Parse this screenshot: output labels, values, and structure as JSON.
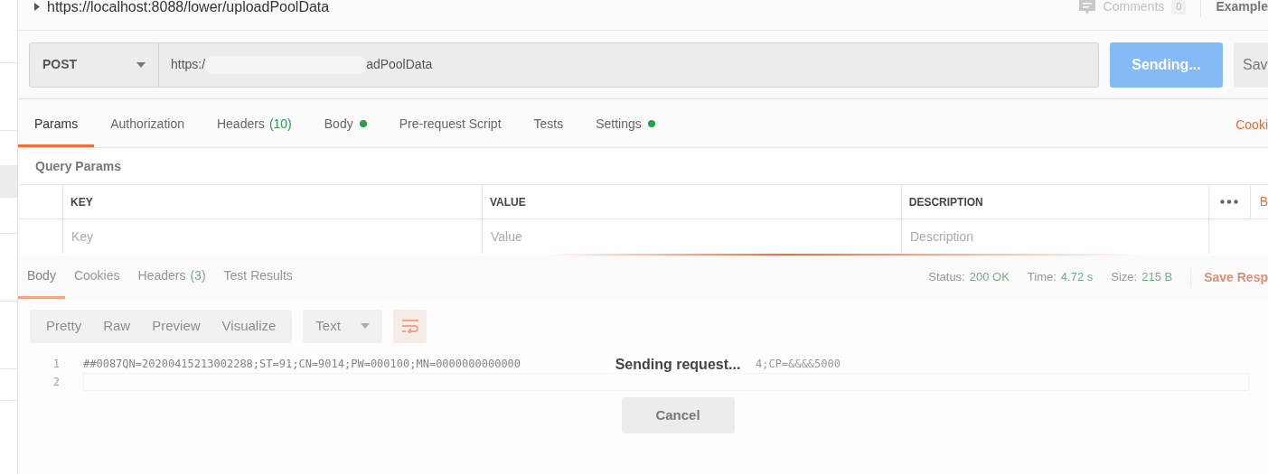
{
  "header": {
    "title": "https://localhost:8088/lower/uploadPoolData",
    "comments_label": "Comments",
    "comments_count": "0",
    "examples": "Example"
  },
  "request": {
    "method": "POST",
    "url_start": "https:/",
    "url_end": "adPoolData",
    "send": "Sending...",
    "save": "Sav"
  },
  "tabs": [
    {
      "label": "Params",
      "selected": true
    },
    {
      "label": "Authorization",
      "selected": false
    },
    {
      "label": "Headers",
      "count": "(10)",
      "selected": false
    },
    {
      "label": "Body",
      "dot": true,
      "selected": false
    },
    {
      "label": "Pre-request Script",
      "selected": false
    },
    {
      "label": "Tests",
      "selected": false
    },
    {
      "label": "Settings",
      "dot": true,
      "selected": false
    }
  ],
  "cookies_link": "Cooki",
  "query_params": {
    "title": "Query Params",
    "columns": [
      "KEY",
      "VALUE",
      "DESCRIPTION"
    ],
    "placeholders": [
      "Key",
      "Value",
      "Description"
    ],
    "bulk_edit": "B"
  },
  "response": {
    "tabs": [
      {
        "label": "Body",
        "selected": true
      },
      {
        "label": "Cookies",
        "selected": false
      },
      {
        "label": "Headers",
        "count": "(3)",
        "selected": false
      },
      {
        "label": "Test Results",
        "selected": false
      }
    ],
    "stats": [
      {
        "label": "Status:",
        "value": "200 OK"
      },
      {
        "label": "Time:",
        "value": "4.72 s"
      },
      {
        "label": "Size:",
        "value": "215 B"
      }
    ],
    "save": "Save Resp",
    "formats": [
      {
        "label": "Pretty"
      },
      {
        "label": "Raw"
      },
      {
        "label": "Preview"
      },
      {
        "label": "Visualize"
      }
    ],
    "language": "Text",
    "lines": [
      {
        "number": "1",
        "text": "##0087QN=20200415213002288;ST=91;CN=9014;PW=000100;MN=0000000000000",
        "tail": "4;CP=&&&&5000"
      },
      {
        "number": "2"
      }
    ]
  },
  "overlay": {
    "message": "Sending request...",
    "cancel": "Cancel"
  }
}
